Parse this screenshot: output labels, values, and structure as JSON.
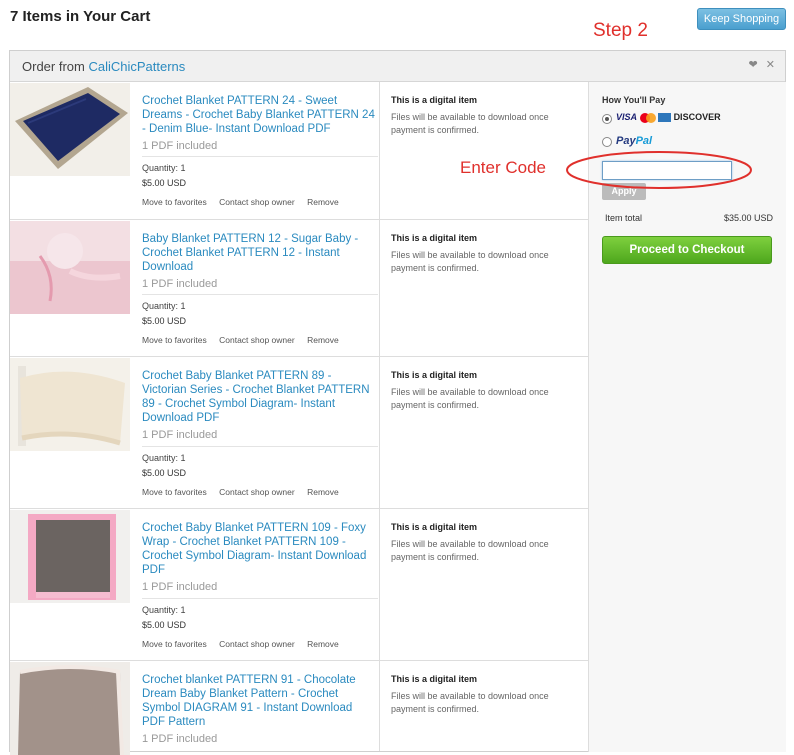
{
  "page": {
    "title": "7 Items in Your Cart",
    "keep_shopping": "Keep Shopping",
    "step_label": "Step 2",
    "enter_code_label": "Enter Code"
  },
  "order": {
    "prefix": "Order from",
    "shop": "CaliChicPatterns",
    "icons": [
      "heart-icon",
      "close-icon"
    ]
  },
  "items": [
    {
      "title": "Crochet Blanket PATTERN 24 - Sweet Dreams - Crochet Baby Blanket PATTERN 24 - Denim Blue- Instant Download PDF",
      "included": "1 PDF included",
      "quantity": "Quantity: 1",
      "price": "$5.00 USD",
      "actions": [
        "Move to favorites",
        "Contact shop owner",
        "Remove"
      ],
      "digital_title": "This is a digital item",
      "digital_text": "Files will be available to download once payment is confirmed."
    },
    {
      "title": "Baby Blanket PATTERN 12 - Sugar Baby - Crochet Blanket PATTERN 12 - Instant Download",
      "included": "1 PDF included",
      "quantity": "Quantity: 1",
      "price": "$5.00 USD",
      "actions": [
        "Move to favorites",
        "Contact shop owner",
        "Remove"
      ],
      "digital_title": "This is a digital item",
      "digital_text": "Files will be available to download once payment is confirmed."
    },
    {
      "title": "Crochet Baby Blanket PATTERN 89 - Victorian Series - Crochet Blanket PATTERN 89 - Crochet Symbol Diagram- Instant Download PDF",
      "included": "1 PDF included",
      "quantity": "Quantity: 1",
      "price": "$5.00 USD",
      "actions": [
        "Move to favorites",
        "Contact shop owner",
        "Remove"
      ],
      "digital_title": "This is a digital item",
      "digital_text": "Files will be available to download once payment is confirmed."
    },
    {
      "title": "Crochet Baby Blanket PATTERN 109 - Foxy Wrap - Crochet Blanket PATTERN 109 - Crochet Symbol Diagram- Instant Download PDF",
      "included": "1 PDF included",
      "quantity": "Quantity: 1",
      "price": "$5.00 USD",
      "actions": [
        "Move to favorites",
        "Contact shop owner",
        "Remove"
      ],
      "digital_title": "This is a digital item",
      "digital_text": "Files will be available to download once payment is confirmed."
    },
    {
      "title": "Crochet blanket PATTERN 91 - Chocolate Dream Baby Blanket Pattern - Crochet Symbol DIAGRAM 91 - Instant Download PDF Pattern",
      "included": "1 PDF included",
      "digital_title": "This is a digital item",
      "digital_text": "Files will be available to download once payment is confirmed."
    }
  ],
  "payment": {
    "title": "How You'll Pay",
    "cards_visa": "VISA",
    "cards_discover": "DISCOVER",
    "paypal_a": "Pay",
    "paypal_b": "Pal",
    "coupon_value": "",
    "apply": "Apply",
    "item_total_label": "Item total",
    "item_total_value": "$35.00 USD",
    "checkout": "Proceed to Checkout"
  },
  "colors": {
    "link": "#2a8abf",
    "annotation_red": "#e0302c",
    "checkout_green": "#5cb82a",
    "keep_shopping_blue": "#5aaedb"
  }
}
